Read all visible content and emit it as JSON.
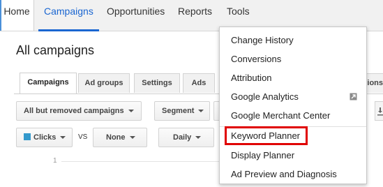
{
  "nav": {
    "home": "Home",
    "campaigns": "Campaigns",
    "opportunities": "Opportunities",
    "reports": "Reports",
    "tools": "Tools"
  },
  "page": {
    "title": "All campaigns"
  },
  "tabs": [
    "Campaigns",
    "Ad groups",
    "Settings",
    "Ads",
    "sions"
  ],
  "filters": {
    "status": "All but removed campaigns",
    "segment": "Segment",
    "metric1": "Clicks",
    "vs": "VS",
    "metric2": "None",
    "interval": "Daily"
  },
  "chart": {
    "axis_tick": "1"
  },
  "tools_menu": {
    "items": [
      "Change History",
      "Conversions",
      "Attribution",
      "Google Analytics",
      "Google Merchant Center",
      "Keyword Planner",
      "Display Planner",
      "Ad Preview and Diagnosis"
    ],
    "highlight_color": "#e00000"
  },
  "colors": {
    "accent": "#1a66d1",
    "clicks_swatch": "#3399cc"
  },
  "icons": {
    "google_analytics_external": "external-link-icon",
    "download": "download-icon"
  }
}
